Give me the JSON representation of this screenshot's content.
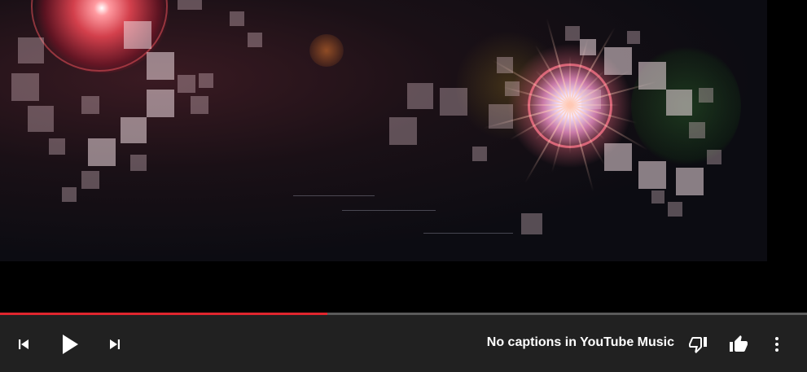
{
  "player_bar": {
    "caption_status": "No captions in YouTube Music",
    "progress_fraction": 0.406,
    "icons": {
      "previous": "skip-previous-icon",
      "play": "play-icon",
      "next": "skip-next-icon",
      "dislike": "thumb-down-icon",
      "like": "thumb-up-icon",
      "menu": "more-vertical-icon"
    },
    "like_state": "liked"
  },
  "colors": {
    "progress_fill": "#e0262e",
    "progress_track": "#5a5a5a",
    "bar_background": "#212121",
    "text": "#ffffff"
  }
}
